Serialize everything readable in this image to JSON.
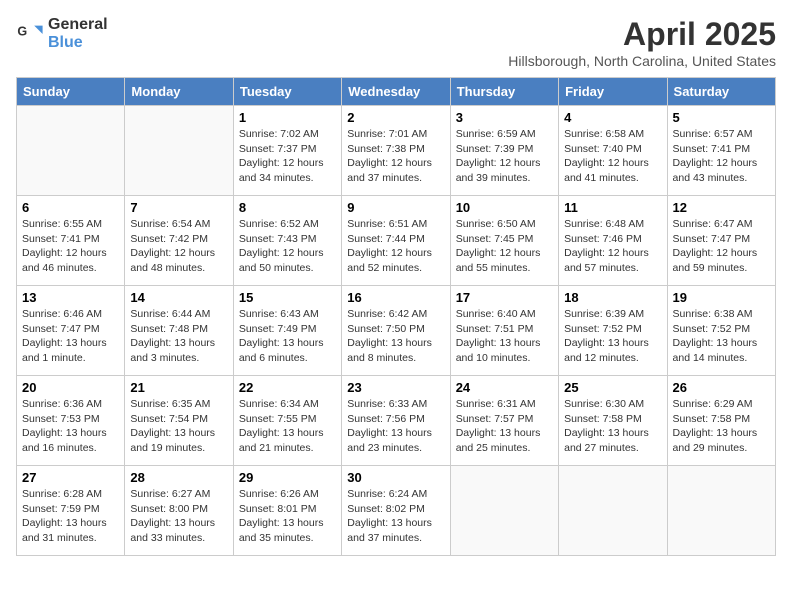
{
  "header": {
    "logo_general": "General",
    "logo_blue": "Blue",
    "month_title": "April 2025",
    "location": "Hillsborough, North Carolina, United States"
  },
  "days_of_week": [
    "Sunday",
    "Monday",
    "Tuesday",
    "Wednesday",
    "Thursday",
    "Friday",
    "Saturday"
  ],
  "weeks": [
    [
      {
        "day": "",
        "info": ""
      },
      {
        "day": "",
        "info": ""
      },
      {
        "day": "1",
        "info": "Sunrise: 7:02 AM\nSunset: 7:37 PM\nDaylight: 12 hours and 34 minutes."
      },
      {
        "day": "2",
        "info": "Sunrise: 7:01 AM\nSunset: 7:38 PM\nDaylight: 12 hours and 37 minutes."
      },
      {
        "day": "3",
        "info": "Sunrise: 6:59 AM\nSunset: 7:39 PM\nDaylight: 12 hours and 39 minutes."
      },
      {
        "day": "4",
        "info": "Sunrise: 6:58 AM\nSunset: 7:40 PM\nDaylight: 12 hours and 41 minutes."
      },
      {
        "day": "5",
        "info": "Sunrise: 6:57 AM\nSunset: 7:41 PM\nDaylight: 12 hours and 43 minutes."
      }
    ],
    [
      {
        "day": "6",
        "info": "Sunrise: 6:55 AM\nSunset: 7:41 PM\nDaylight: 12 hours and 46 minutes."
      },
      {
        "day": "7",
        "info": "Sunrise: 6:54 AM\nSunset: 7:42 PM\nDaylight: 12 hours and 48 minutes."
      },
      {
        "day": "8",
        "info": "Sunrise: 6:52 AM\nSunset: 7:43 PM\nDaylight: 12 hours and 50 minutes."
      },
      {
        "day": "9",
        "info": "Sunrise: 6:51 AM\nSunset: 7:44 PM\nDaylight: 12 hours and 52 minutes."
      },
      {
        "day": "10",
        "info": "Sunrise: 6:50 AM\nSunset: 7:45 PM\nDaylight: 12 hours and 55 minutes."
      },
      {
        "day": "11",
        "info": "Sunrise: 6:48 AM\nSunset: 7:46 PM\nDaylight: 12 hours and 57 minutes."
      },
      {
        "day": "12",
        "info": "Sunrise: 6:47 AM\nSunset: 7:47 PM\nDaylight: 12 hours and 59 minutes."
      }
    ],
    [
      {
        "day": "13",
        "info": "Sunrise: 6:46 AM\nSunset: 7:47 PM\nDaylight: 13 hours and 1 minute."
      },
      {
        "day": "14",
        "info": "Sunrise: 6:44 AM\nSunset: 7:48 PM\nDaylight: 13 hours and 3 minutes."
      },
      {
        "day": "15",
        "info": "Sunrise: 6:43 AM\nSunset: 7:49 PM\nDaylight: 13 hours and 6 minutes."
      },
      {
        "day": "16",
        "info": "Sunrise: 6:42 AM\nSunset: 7:50 PM\nDaylight: 13 hours and 8 minutes."
      },
      {
        "day": "17",
        "info": "Sunrise: 6:40 AM\nSunset: 7:51 PM\nDaylight: 13 hours and 10 minutes."
      },
      {
        "day": "18",
        "info": "Sunrise: 6:39 AM\nSunset: 7:52 PM\nDaylight: 13 hours and 12 minutes."
      },
      {
        "day": "19",
        "info": "Sunrise: 6:38 AM\nSunset: 7:52 PM\nDaylight: 13 hours and 14 minutes."
      }
    ],
    [
      {
        "day": "20",
        "info": "Sunrise: 6:36 AM\nSunset: 7:53 PM\nDaylight: 13 hours and 16 minutes."
      },
      {
        "day": "21",
        "info": "Sunrise: 6:35 AM\nSunset: 7:54 PM\nDaylight: 13 hours and 19 minutes."
      },
      {
        "day": "22",
        "info": "Sunrise: 6:34 AM\nSunset: 7:55 PM\nDaylight: 13 hours and 21 minutes."
      },
      {
        "day": "23",
        "info": "Sunrise: 6:33 AM\nSunset: 7:56 PM\nDaylight: 13 hours and 23 minutes."
      },
      {
        "day": "24",
        "info": "Sunrise: 6:31 AM\nSunset: 7:57 PM\nDaylight: 13 hours and 25 minutes."
      },
      {
        "day": "25",
        "info": "Sunrise: 6:30 AM\nSunset: 7:58 PM\nDaylight: 13 hours and 27 minutes."
      },
      {
        "day": "26",
        "info": "Sunrise: 6:29 AM\nSunset: 7:58 PM\nDaylight: 13 hours and 29 minutes."
      }
    ],
    [
      {
        "day": "27",
        "info": "Sunrise: 6:28 AM\nSunset: 7:59 PM\nDaylight: 13 hours and 31 minutes."
      },
      {
        "day": "28",
        "info": "Sunrise: 6:27 AM\nSunset: 8:00 PM\nDaylight: 13 hours and 33 minutes."
      },
      {
        "day": "29",
        "info": "Sunrise: 6:26 AM\nSunset: 8:01 PM\nDaylight: 13 hours and 35 minutes."
      },
      {
        "day": "30",
        "info": "Sunrise: 6:24 AM\nSunset: 8:02 PM\nDaylight: 13 hours and 37 minutes."
      },
      {
        "day": "",
        "info": ""
      },
      {
        "day": "",
        "info": ""
      },
      {
        "day": "",
        "info": ""
      }
    ]
  ]
}
